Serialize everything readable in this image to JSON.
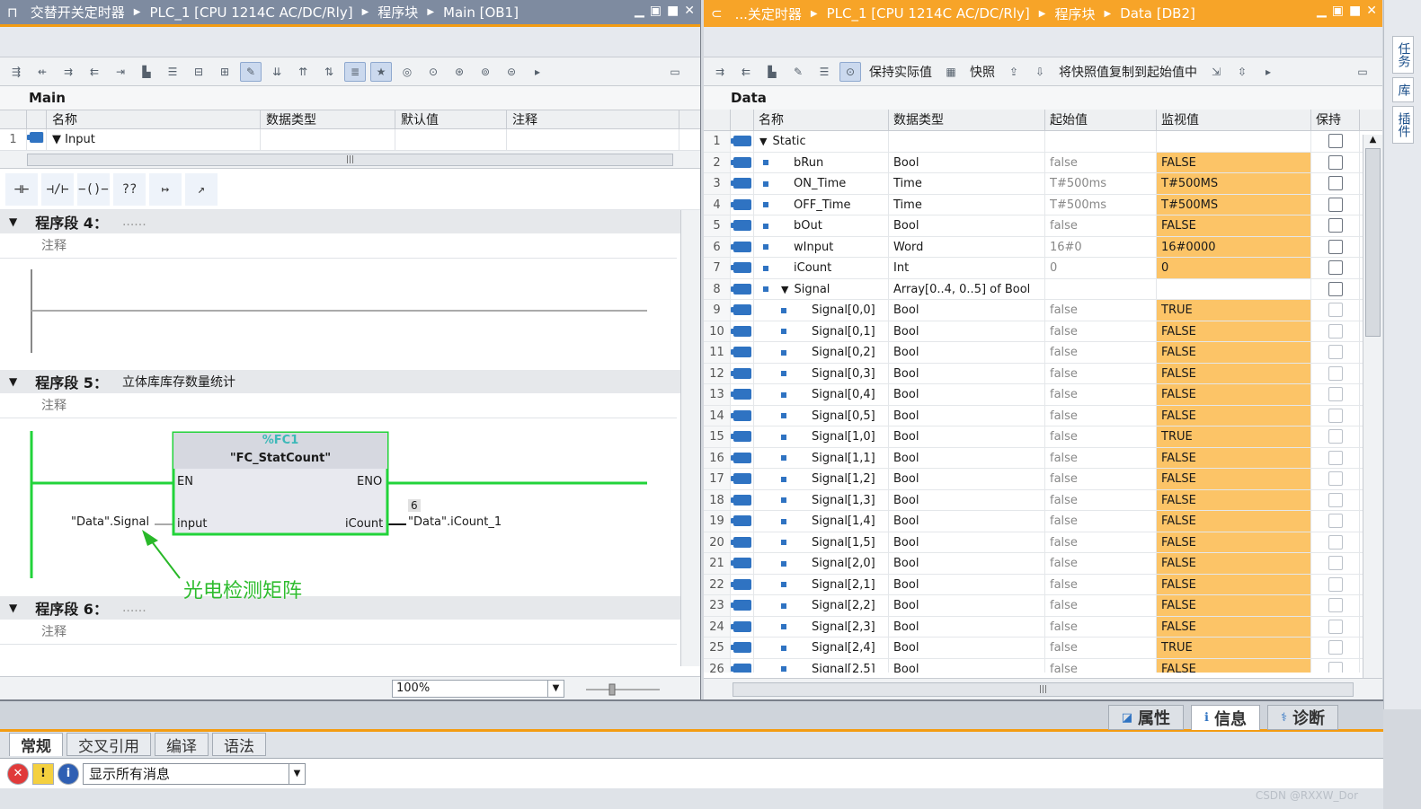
{
  "left": {
    "title": [
      "交替开关定时器",
      "PLC_1 [CPU 1214C AC/DC/Rly]",
      "程序块",
      "Main [OB1]"
    ],
    "block_name": "Main",
    "interface_headers": [
      "名称",
      "数据类型",
      "默认值",
      "注释"
    ],
    "interface_rows": [
      {
        "num": "1",
        "name": "Input"
      }
    ],
    "zoom": "100%",
    "networks": [
      {
        "label": "程序段 4：",
        "title": "......",
        "comment": "注释"
      },
      {
        "label": "程序段 5：",
        "title": "立体库库存数量统计",
        "comment": "注释"
      },
      {
        "label": "程序段 6：",
        "title": "......",
        "comment": "注释"
      }
    ],
    "fc": {
      "address": "%FC1",
      "name": "\"FC_StatCount\"",
      "en": "EN",
      "eno": "ENO",
      "in_pin": "input",
      "out_pin": "iCount",
      "in_operand": "\"Data\".Signal",
      "out_operand": "\"Data\".iCount_1",
      "out_value": "6"
    },
    "annotation": "光电检测矩阵"
  },
  "right": {
    "title": [
      "...关定时器",
      "PLC_1 [CPU 1214C AC/DC/Rly]",
      "程序块",
      "Data [DB2]"
    ],
    "toolbar_labels": {
      "keep": "保持实际值",
      "snapshot": "快照",
      "copy": "将快照值复制到起始值中"
    },
    "block_name": "Data",
    "headers": [
      "名称",
      "数据类型",
      "起始值",
      "监视值",
      "保持"
    ],
    "rows": [
      {
        "num": "1",
        "name": "Static",
        "type": "",
        "start": "",
        "mon": "",
        "level": 0,
        "expand": true
      },
      {
        "num": "2",
        "name": "bRun",
        "type": "Bool",
        "start": "false",
        "mon": "FALSE",
        "level": 1
      },
      {
        "num": "3",
        "name": "ON_Time",
        "type": "Time",
        "start": "T#500ms",
        "mon": "T#500MS",
        "level": 1
      },
      {
        "num": "4",
        "name": "OFF_Time",
        "type": "Time",
        "start": "T#500ms",
        "mon": "T#500MS",
        "level": 1
      },
      {
        "num": "5",
        "name": "bOut",
        "type": "Bool",
        "start": "false",
        "mon": "FALSE",
        "level": 1
      },
      {
        "num": "6",
        "name": "wInput",
        "type": "Word",
        "start": "16#0",
        "mon": "16#0000",
        "level": 1
      },
      {
        "num": "7",
        "name": "iCount",
        "type": "Int",
        "start": "0",
        "mon": "0",
        "level": 1
      },
      {
        "num": "8",
        "name": "Signal",
        "type": "Array[0..4, 0..5] of Bool",
        "start": "",
        "mon": "",
        "level": 1,
        "expand": true
      },
      {
        "num": "9",
        "name": "Signal[0,0]",
        "type": "Bool",
        "start": "false",
        "mon": "TRUE",
        "level": 2
      },
      {
        "num": "10",
        "name": "Signal[0,1]",
        "type": "Bool",
        "start": "false",
        "mon": "FALSE",
        "level": 2
      },
      {
        "num": "11",
        "name": "Signal[0,2]",
        "type": "Bool",
        "start": "false",
        "mon": "FALSE",
        "level": 2
      },
      {
        "num": "12",
        "name": "Signal[0,3]",
        "type": "Bool",
        "start": "false",
        "mon": "FALSE",
        "level": 2
      },
      {
        "num": "13",
        "name": "Signal[0,4]",
        "type": "Bool",
        "start": "false",
        "mon": "FALSE",
        "level": 2
      },
      {
        "num": "14",
        "name": "Signal[0,5]",
        "type": "Bool",
        "start": "false",
        "mon": "FALSE",
        "level": 2
      },
      {
        "num": "15",
        "name": "Signal[1,0]",
        "type": "Bool",
        "start": "false",
        "mon": "TRUE",
        "level": 2
      },
      {
        "num": "16",
        "name": "Signal[1,1]",
        "type": "Bool",
        "start": "false",
        "mon": "FALSE",
        "level": 2
      },
      {
        "num": "17",
        "name": "Signal[1,2]",
        "type": "Bool",
        "start": "false",
        "mon": "FALSE",
        "level": 2
      },
      {
        "num": "18",
        "name": "Signal[1,3]",
        "type": "Bool",
        "start": "false",
        "mon": "FALSE",
        "level": 2
      },
      {
        "num": "19",
        "name": "Signal[1,4]",
        "type": "Bool",
        "start": "false",
        "mon": "FALSE",
        "level": 2
      },
      {
        "num": "20",
        "name": "Signal[1,5]",
        "type": "Bool",
        "start": "false",
        "mon": "FALSE",
        "level": 2
      },
      {
        "num": "21",
        "name": "Signal[2,0]",
        "type": "Bool",
        "start": "false",
        "mon": "FALSE",
        "level": 2
      },
      {
        "num": "22",
        "name": "Signal[2,1]",
        "type": "Bool",
        "start": "false",
        "mon": "FALSE",
        "level": 2
      },
      {
        "num": "23",
        "name": "Signal[2,2]",
        "type": "Bool",
        "start": "false",
        "mon": "FALSE",
        "level": 2
      },
      {
        "num": "24",
        "name": "Signal[2,3]",
        "type": "Bool",
        "start": "false",
        "mon": "FALSE",
        "level": 2
      },
      {
        "num": "25",
        "name": "Signal[2,4]",
        "type": "Bool",
        "start": "false",
        "mon": "TRUE",
        "level": 2
      },
      {
        "num": "26",
        "name": "Signal[2,5]",
        "type": "Bool",
        "start": "false",
        "mon": "FALSE",
        "level": 2
      }
    ]
  },
  "sidebar": [
    "任务",
    "库",
    "插件"
  ],
  "bottom": {
    "inspector_tabs": [
      "属性",
      "信息",
      "诊断"
    ],
    "sub_tabs": [
      "常规",
      "交叉引用",
      "编译",
      "语法"
    ],
    "filter": "显示所有消息"
  },
  "credit": "CSDN @RXXW_Dor",
  "colors": {
    "accent": "#f39c12",
    "monitor": "#fcc467",
    "rung": "#22d33a",
    "annotation": "#2ebc2e"
  }
}
